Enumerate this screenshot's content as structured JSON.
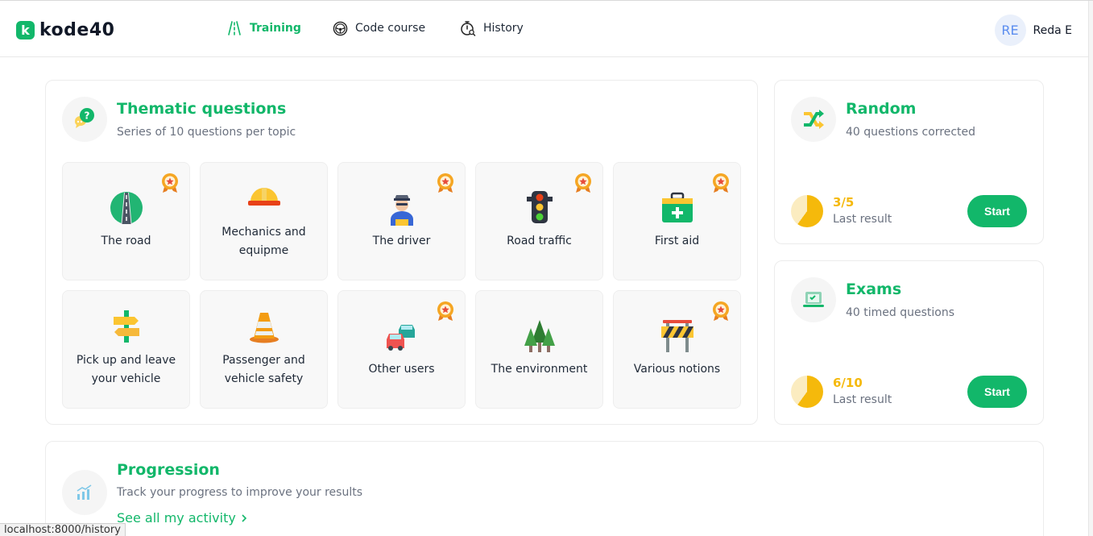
{
  "brand": {
    "name": "kode40",
    "mark": "k",
    "color": "#12b76a"
  },
  "nav": [
    {
      "label": "Training",
      "icon": "road-icon",
      "active": true
    },
    {
      "label": "Code course",
      "icon": "steering-wheel-icon",
      "active": false
    },
    {
      "label": "History",
      "icon": "stopwatch-icon",
      "active": false
    }
  ],
  "user": {
    "initials": "RE",
    "name": "Reda E"
  },
  "thematic": {
    "title": "Thematic questions",
    "subtitle": "Series of 10 questions per topic",
    "icon": "question-bubble-icon",
    "topics": [
      {
        "label": "The road",
        "icon": "road-icon",
        "medal": true
      },
      {
        "label": "Mechanics and equipme",
        "icon": "hard-hat-icon",
        "medal": false
      },
      {
        "label": "The driver",
        "icon": "driver-icon",
        "medal": true
      },
      {
        "label": "Road traffic",
        "icon": "traffic-light-icon",
        "medal": true
      },
      {
        "label": "First aid",
        "icon": "first-aid-kit-icon",
        "medal": true
      },
      {
        "label": "Pick up and leave your vehicle",
        "icon": "signpost-icon",
        "medal": false
      },
      {
        "label": "Passenger and vehicle safety",
        "icon": "traffic-cone-icon",
        "medal": false
      },
      {
        "label": "Other users",
        "icon": "cars-icon",
        "medal": true
      },
      {
        "label": "The environment",
        "icon": "trees-icon",
        "medal": false
      },
      {
        "label": "Various notions",
        "icon": "road-barrier-icon",
        "medal": true
      }
    ]
  },
  "random": {
    "title": "Random",
    "subtitle": "40 questions corrected",
    "icon": "shuffle-icon",
    "score": "3/5",
    "score_fraction": 0.6,
    "result_label": "Last result",
    "button": "Start"
  },
  "exams": {
    "title": "Exams",
    "subtitle": "40 timed questions",
    "icon": "laptop-check-icon",
    "score": "6/10",
    "score_fraction": 0.6,
    "result_label": "Last result",
    "button": "Start"
  },
  "progression": {
    "title": "Progression",
    "subtitle": "Track your progress to improve your results",
    "icon": "bar-chart-icon",
    "link": "See all my activity"
  },
  "status_bar": {
    "url": "localhost:8000/history"
  },
  "colors": {
    "accent": "#12b76a",
    "score": "#f5b90b",
    "muted": "#6b7280"
  }
}
